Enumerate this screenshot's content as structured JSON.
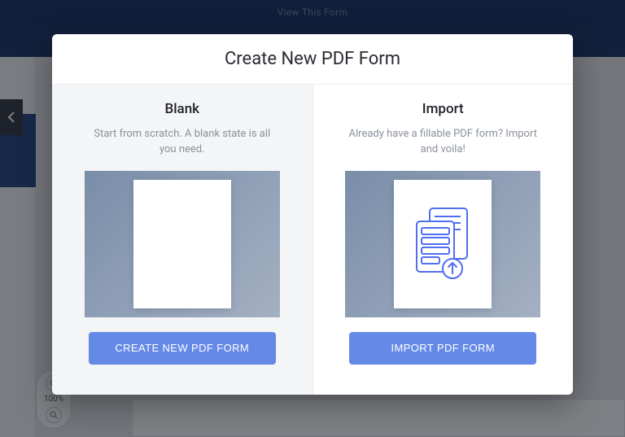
{
  "background": {
    "header_text": "View This Form",
    "zoom_label": "100%"
  },
  "modal": {
    "title": "Create New PDF Form",
    "options": {
      "blank": {
        "title": "Blank",
        "description": "Start from scratch. A blank state is all you need.",
        "button_label": "CREATE NEW PDF FORM"
      },
      "import": {
        "title": "Import",
        "description": "Already have a fillable PDF form? Import and voila!",
        "button_label": "IMPORT PDF FORM"
      }
    }
  },
  "colors": {
    "accent": "#6589e6",
    "icon_blue": "#4f6ef0"
  }
}
